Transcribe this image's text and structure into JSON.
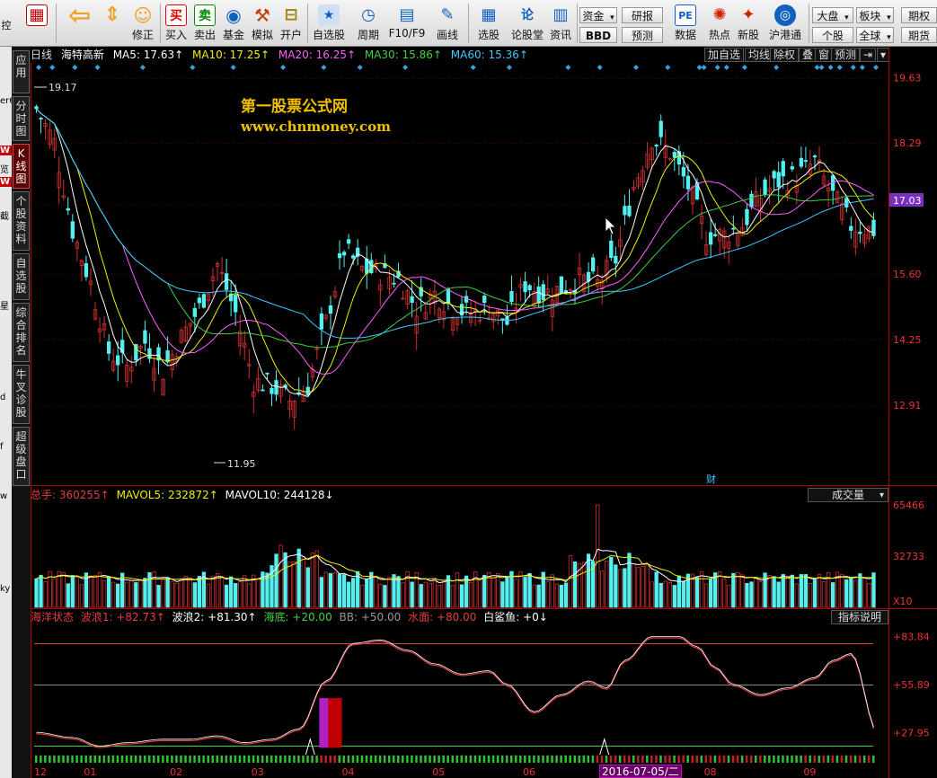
{
  "toolbar": {
    "left_glyph": "控",
    "buttons": [
      {
        "name": "back",
        "label": "",
        "icon": "arrow-left-icon",
        "glyph": "⇦",
        "color": "#f0a020"
      },
      {
        "name": "correct",
        "label": "修正",
        "icon": "updown-arrows-icon",
        "glyph": "⇕",
        "color": "#f0a020"
      },
      {
        "name": "correct2",
        "label": "",
        "icon": "smiley-icon",
        "glyph": "☺",
        "color": "#f0a020"
      },
      {
        "name": "buy",
        "label": "买入",
        "icon": "buy-icon",
        "glyph": "买",
        "color": "#e00000"
      },
      {
        "name": "sell",
        "label": "卖出",
        "icon": "sell-icon",
        "glyph": "卖",
        "color": "#008800"
      },
      {
        "name": "fund",
        "label": "基金",
        "icon": "fund-icon",
        "glyph": "◉",
        "color": "#1060c0"
      },
      {
        "name": "simulate",
        "label": "模拟",
        "icon": "hammer-icon",
        "glyph": "⚒",
        "color": "#c04000"
      },
      {
        "name": "open-account",
        "label": "开户",
        "icon": "lock-icon",
        "glyph": "🔒",
        "color": "#a08000"
      },
      {
        "name": "watchlist",
        "label": "自选股",
        "icon": "star-icon",
        "glyph": "★",
        "color": "#1060c0"
      },
      {
        "name": "period",
        "label": "周期",
        "icon": "clock-icon",
        "glyph": "◷",
        "color": "#1060c0"
      },
      {
        "name": "f10",
        "label": "F10/F9",
        "icon": "document-icon",
        "glyph": "▤",
        "color": "#1060c0"
      },
      {
        "name": "draw",
        "label": "画线",
        "icon": "pen-icon",
        "glyph": "✎",
        "color": "#1060c0"
      },
      {
        "name": "pick",
        "label": "选股",
        "icon": "pick-icon",
        "glyph": "▦",
        "color": "#1060c0"
      },
      {
        "name": "forum",
        "label": "论股堂",
        "icon": "forum-icon",
        "glyph": "论",
        "color": "#1060c0"
      },
      {
        "name": "news",
        "label": "资讯",
        "icon": "news-icon",
        "glyph": "▥",
        "color": "#1060c0"
      },
      {
        "name": "data",
        "label": "数据",
        "icon": "pe-icon",
        "glyph": "PE",
        "color": "#1060c0"
      },
      {
        "name": "hot",
        "label": "热点",
        "icon": "hot-icon",
        "glyph": "✺",
        "color": "#d02000"
      },
      {
        "name": "ipo",
        "label": "新股",
        "icon": "ipo-icon",
        "glyph": "✦",
        "color": "#d02000"
      },
      {
        "name": "hk-connect",
        "label": "沪港通",
        "icon": "hk-connect-icon",
        "glyph": "◎",
        "color": "#1060c0"
      }
    ],
    "small": {
      "capital": "资金",
      "bbd": "BBD",
      "research": "研报",
      "forecast": "预测",
      "market": "大盘",
      "sector": "板块",
      "futures": "期权",
      "stock": "个股",
      "global": "全球",
      "futures2": "期货"
    }
  },
  "left_strip": [
    "控",
    "er6",
    "W",
    "览",
    "W",
    "截",
    "星",
    "d",
    "f",
    "w",
    "ky"
  ],
  "side_tabs": [
    {
      "label": "应用",
      "active": false
    },
    {
      "label": "分时图",
      "active": false
    },
    {
      "label": "K线图",
      "active": true
    },
    {
      "label": "个股资料",
      "active": false
    },
    {
      "label": "自选股",
      "active": false
    },
    {
      "label": "综合排名",
      "active": false
    },
    {
      "label": "牛叉诊股",
      "active": false
    },
    {
      "label": "超级盘口",
      "active": false
    }
  ],
  "header": {
    "period": "日线",
    "stock_name": "海特高新",
    "ma5": "MA5: 17.63↑",
    "ma10": "MA10: 17.25↑",
    "ma20": "MA20: 16.25↑",
    "ma30": "MA30: 15.86↑",
    "ma60": "MA60: 15.36↑",
    "buttons": [
      "加自选",
      "均线",
      "除权",
      "叠",
      "窗",
      "预测"
    ],
    "pin_glyph": "⇥"
  },
  "colors": {
    "ma5": "#ffffff",
    "ma10": "#f0f000",
    "ma20": "#ff60ff",
    "ma30": "#40d040",
    "ma60": "#40c8ff",
    "up": "#d03030",
    "down": "#54f0f0",
    "axis": "#c00000",
    "price_tag_bg": "#7b2fbf"
  },
  "price_axis": [
    "19.63",
    "18.29",
    "17.03",
    "15.60",
    "14.25",
    "12.91"
  ],
  "current_price": "17.03",
  "annotations": {
    "high": "19.17",
    "low": "11.95",
    "finance_mark": "财"
  },
  "watermark": {
    "line1": "第一股票公式网",
    "line2": "www.chnmoney.com"
  },
  "volume": {
    "total": "总手: 360255↑",
    "mavol5": "MAVOL5: 232872↑",
    "mavol10": "MAVOL10: 244128↓",
    "select": "成交量",
    "axis": [
      "65466",
      "32733",
      "X10"
    ]
  },
  "indicator": {
    "name": "海洋状态",
    "wave1": "波浪1: +82.73↑",
    "wave2": "波浪2: +81.30↑",
    "seabed": "海底: +20.00",
    "bb": "BB: +50.00",
    "water": "水面: +80.00",
    "shark": "白鲨鱼: +0↓",
    "help": "指标说明",
    "axis": [
      "+83.84",
      "+55.89",
      "+27.95"
    ]
  },
  "x_axis": [
    "12",
    "01",
    "02",
    "03",
    "04",
    "05",
    "06",
    "07",
    "08",
    "09"
  ],
  "cursor_date": "2016-07-05/二"
}
